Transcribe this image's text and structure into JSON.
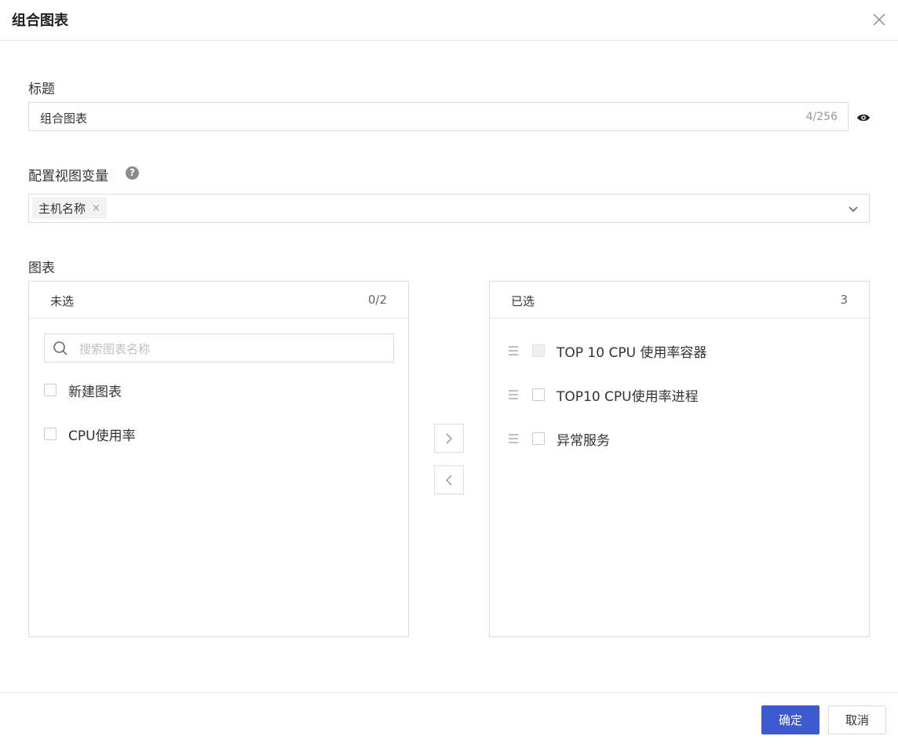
{
  "dialog": {
    "title": "组合图表"
  },
  "title_field": {
    "label": "标题",
    "value": "组合图表",
    "counter": "4/256"
  },
  "variables": {
    "label": "配置视图变量",
    "help_glyph": "?",
    "tags": [
      "主机名称"
    ],
    "tag_remove": "×"
  },
  "charts": {
    "label": "图表",
    "unselected": {
      "title": "未选",
      "count": "0/2",
      "search_placeholder": "搜索图表名称",
      "items": [
        "新建图表",
        "CPU使用率"
      ]
    },
    "selected": {
      "title": "已选",
      "count": "3",
      "items": [
        "TOP 10 CPU 使用率容器",
        "TOP10 CPU使用率进程",
        "异常服务"
      ]
    }
  },
  "footer": {
    "confirm": "确定",
    "cancel": "取消"
  },
  "colors": {
    "primary": "#3d5bcf",
    "border": "#dcdcdc"
  },
  "icons": [
    "close-icon",
    "eye-icon",
    "help-icon",
    "chevron-down-icon",
    "search-icon",
    "drag-handle-icon",
    "arrow-right-icon",
    "arrow-left-icon"
  ]
}
